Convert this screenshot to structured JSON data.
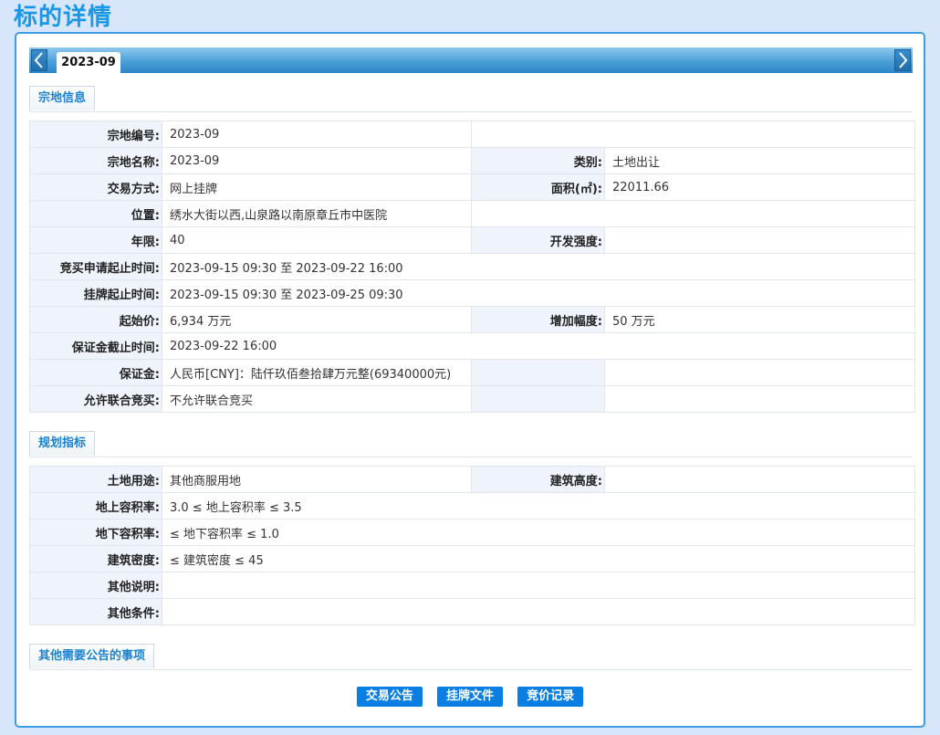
{
  "page": {
    "title": "标的详情"
  },
  "tabs": {
    "active": "2023-09"
  },
  "sections": {
    "land_info": "宗地信息",
    "planning": "规划指标",
    "other_matters": "其他需要公告的事项"
  },
  "land_info": {
    "parcel_no": {
      "label": "宗地编号:",
      "value": "2023-09"
    },
    "parcel_name": {
      "label": "宗地名称:",
      "value": "2023-09"
    },
    "category": {
      "label": "类别:",
      "value": "土地出让"
    },
    "trade_method": {
      "label": "交易方式:",
      "value": "网上挂牌"
    },
    "area": {
      "label": "面积(㎡):",
      "value": "22011.66"
    },
    "location": {
      "label": "位置:",
      "value": "绣水大街以西,山泉路以南原章丘市中医院"
    },
    "term": {
      "label": "年限:",
      "value": "40"
    },
    "dev_intensity": {
      "label": "开发强度:",
      "value": ""
    },
    "apply_period": {
      "label": "竞买申请起止时间:",
      "value": "2023-09-15 09:30 至 2023-09-22 16:00"
    },
    "listing_period": {
      "label": "挂牌起止时间:",
      "value": "2023-09-15 09:30 至 2023-09-25 09:30"
    },
    "start_price": {
      "label": "起始价:",
      "value": "6,934 万元"
    },
    "increment": {
      "label": "增加幅度:",
      "value": "50 万元"
    },
    "deposit_deadline": {
      "label": "保证金截止时间:",
      "value": "2023-09-22 16:00"
    },
    "deposit": {
      "label": "保证金:",
      "value": "人民币[CNY]：陆仟玖佰叁拾肆万元整(69340000元)"
    },
    "joint_bid": {
      "label": "允许联合竞买:",
      "value": "不允许联合竞买"
    }
  },
  "planning": {
    "land_use": {
      "label": "土地用途:",
      "value": "其他商服用地"
    },
    "building_height": {
      "label": "建筑高度:",
      "value": ""
    },
    "above_far": {
      "label": "地上容积率:",
      "value": "3.0 ≤ 地上容积率 ≤ 3.5"
    },
    "below_far": {
      "label": "地下容积率:",
      "value": "≤ 地下容积率 ≤ 1.0"
    },
    "density": {
      "label": "建筑密度:",
      "value": "≤ 建筑密度 ≤ 45"
    },
    "other_notes": {
      "label": "其他说明:",
      "value": ""
    },
    "other_conditions": {
      "label": "其他条件:",
      "value": ""
    }
  },
  "buttons": {
    "announcement": "交易公告",
    "listing_docs": "挂牌文件",
    "bid_records": "竞价记录"
  },
  "colors": {
    "title": "#1a98e6",
    "panel_border": "#3d9ee5",
    "button": "#0a7fe3",
    "label_bg": "#eef3fc"
  }
}
